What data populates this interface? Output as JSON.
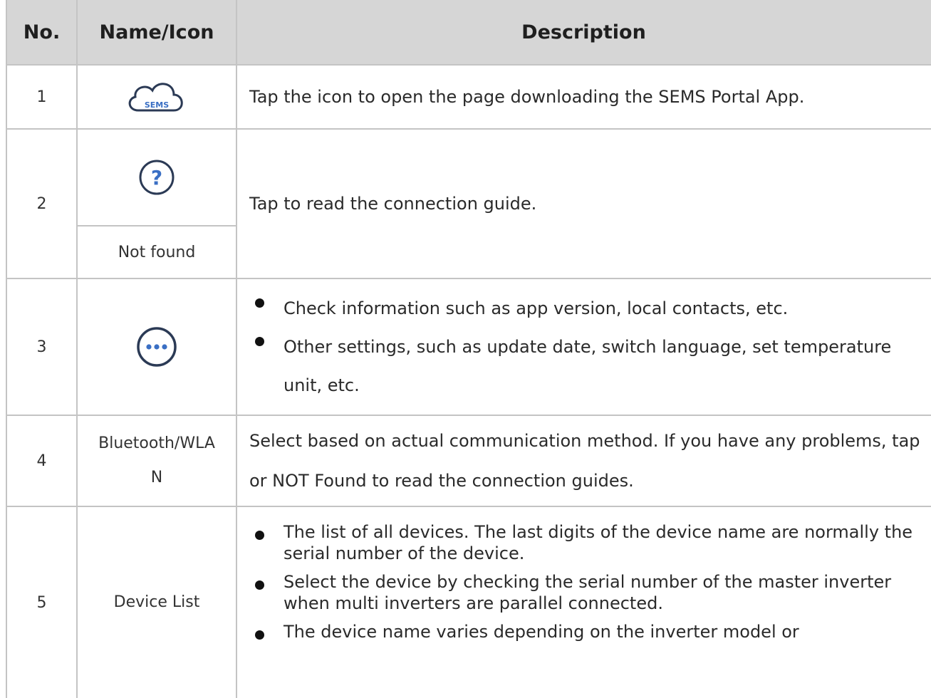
{
  "headers": {
    "no": "No.",
    "name": "Name/Icon",
    "description": "Description"
  },
  "rows": [
    {
      "no": "1",
      "icon": "sems-cloud-icon",
      "icon_text": "SEMS",
      "description": "Tap the icon to open the page downloading the SEMS Portal App."
    },
    {
      "no": "2",
      "icon": "help-question-icon",
      "icon_text": "?",
      "name_below": "Not found",
      "description": "Tap to read the connection guide."
    },
    {
      "no": "3",
      "icon": "more-options-icon",
      "bullets": [
        "Check information such as app version, local contacts, etc.",
        "Other settings, such as update date, switch language, set temperature unit, etc."
      ]
    },
    {
      "no": "4",
      "name": "Bluetooth/WLAN",
      "description": "Select based on actual communication method. If you have any problems, tap or NOT Found to read the connection guides."
    },
    {
      "no": "5",
      "name": "Device List",
      "bullets": [
        "The list of all devices. The last digits of the device name are normally the serial number of the device.",
        "Select the device by checking the serial number of the master inverter when multi inverters are parallel connected.",
        "The device name varies depending on the inverter model or"
      ]
    }
  ],
  "colors": {
    "header_bg": "#d6d6d6",
    "grid": "#c4c4c4",
    "icon_blue": "#3a6fc4",
    "icon_dark": "#2b3a55"
  }
}
